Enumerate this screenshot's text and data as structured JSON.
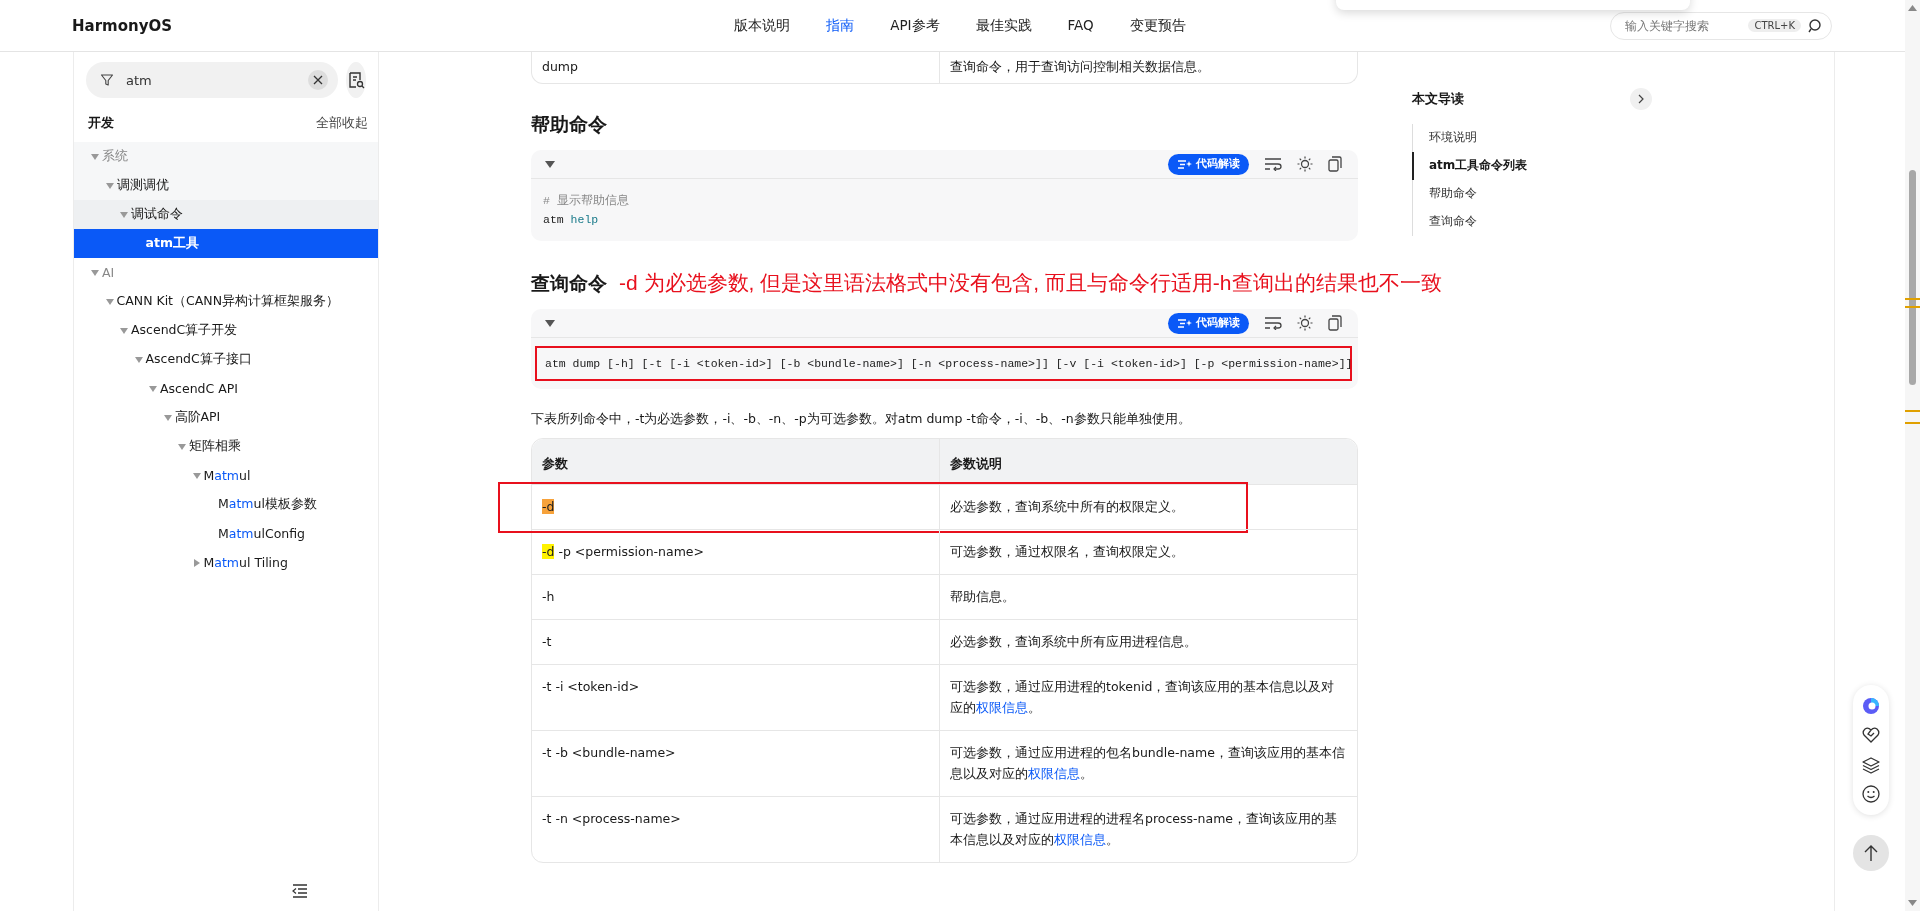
{
  "header": {
    "logo": "HarmonyOS",
    "nav": [
      {
        "label": "版本说明",
        "selected": false
      },
      {
        "label": "指南",
        "selected": true
      },
      {
        "label": "API参考",
        "selected": false
      },
      {
        "label": "最佳实践",
        "selected": false
      },
      {
        "label": "FAQ",
        "selected": false
      },
      {
        "label": "变更预告",
        "selected": false
      }
    ],
    "search": {
      "placeholder": "输入关键字搜索",
      "shortcut": "CTRL+K"
    }
  },
  "sidebar": {
    "filter": {
      "value": "atm"
    },
    "section": "开发",
    "collapse_all": "全部收起",
    "tree": [
      {
        "parts": [
          {
            "text": "系统",
            "match": false
          }
        ],
        "expanded": true,
        "selected": false,
        "children": [
          {
            "parts": [
              {
                "text": "调测调优",
                "match": false
              }
            ],
            "expanded": true,
            "selected": false,
            "children": [
              {
                "parts": [
                  {
                    "text": "调试命令",
                    "match": false
                  }
                ],
                "expanded": true,
                "selected": false,
                "children": [
                  {
                    "parts": [
                      {
                        "text": "atm",
                        "match": true
                      },
                      {
                        "text": "工具",
                        "match": false
                      }
                    ],
                    "selected": true
                  }
                ]
              }
            ]
          }
        ]
      },
      {
        "parts": [
          {
            "text": "AI",
            "match": false
          }
        ],
        "expanded": true,
        "selected": false,
        "children": [
          {
            "parts": [
              {
                "text": "CANN Kit（CANN异构计算框架服务）",
                "match": false
              }
            ],
            "expanded": true,
            "selected": false,
            "children": [
              {
                "parts": [
                  {
                    "text": "AscendC算子开发",
                    "match": false
                  }
                ],
                "expanded": true,
                "selected": false,
                "children": [
                  {
                    "parts": [
                      {
                        "text": "AscendC算子接口",
                        "match": false
                      }
                    ],
                    "expanded": true,
                    "selected": false,
                    "children": [
                      {
                        "parts": [
                          {
                            "text": "AscendC API",
                            "match": false
                          }
                        ],
                        "expanded": true,
                        "selected": false,
                        "children": [
                          {
                            "parts": [
                              {
                                "text": "高阶API",
                                "match": false
                              }
                            ],
                            "expanded": true,
                            "selected": false,
                            "children": [
                              {
                                "parts": [
                                  {
                                    "text": "矩阵相乘",
                                    "match": false
                                  }
                                ],
                                "expanded": true,
                                "selected": false,
                                "children": [
                                  {
                                    "parts": [
                                      {
                                        "text": "M",
                                        "match": false
                                      },
                                      {
                                        "text": "atm",
                                        "match": true
                                      },
                                      {
                                        "text": "ul",
                                        "match": false
                                      }
                                    ],
                                    "expanded": true,
                                    "selected": false,
                                    "children": [
                                      {
                                        "parts": [
                                          {
                                            "text": "M",
                                            "match": false
                                          },
                                          {
                                            "text": "atm",
                                            "match": true
                                          },
                                          {
                                            "text": "ul模板参数",
                                            "match": false
                                          }
                                        ],
                                        "selected": false
                                      },
                                      {
                                        "parts": [
                                          {
                                            "text": "M",
                                            "match": false
                                          },
                                          {
                                            "text": "atm",
                                            "match": true
                                          },
                                          {
                                            "text": "ulConfig",
                                            "match": false
                                          }
                                        ],
                                        "selected": false
                                      }
                                    ]
                                  },
                                  {
                                    "parts": [
                                      {
                                        "text": "M",
                                        "match": false
                                      },
                                      {
                                        "text": "atm",
                                        "match": true
                                      },
                                      {
                                        "text": "ul Tiling",
                                        "match": false
                                      }
                                    ],
                                    "expanded": false,
                                    "selected": false
                                  }
                                ]
                              }
                            ]
                          }
                        ]
                      }
                    ]
                  }
                ]
              }
            ]
          }
        ]
      }
    ]
  },
  "content": {
    "blocks": [
      {
        "kind": "table",
        "rows": [
          {
            "param": [
              {
                "text": "dump"
              }
            ],
            "description": [
              {
                "text": "查询命令，用于查询访问控制相关数据信息。"
              }
            ],
            "annotated": false
          }
        ]
      },
      {
        "kind": "heading",
        "text": "帮助命令"
      },
      {
        "kind": "code",
        "button": "代码解读",
        "annotated": false,
        "lines": [
          [
            {
              "text": "# 显示帮助信息",
              "kind": "comment"
            }
          ],
          [
            {
              "text": "atm ",
              "kind": "plain"
            },
            {
              "text": "help",
              "kind": "keyword"
            }
          ]
        ]
      },
      {
        "kind": "heading",
        "text": "查询命令",
        "annotation": "-d 为必选参数, 但是这里语法格式中没有包含, 而且与命令行适用-h查询出的结果也不一致"
      },
      {
        "kind": "code",
        "button": "代码解读",
        "annotated": true,
        "lines": [
          [
            {
              "text": "atm dump [-h] [-t [-i <token-id>] [-b <bundle-name>] [-n <process-name>]] [-v [-i <token-id>] [-p <permission-name>]]",
              "kind": "plain"
            }
          ]
        ]
      },
      {
        "kind": "paragraph",
        "text": "下表所列命令中，-t为必选参数，-i、-b、-n、-p为可选参数。对atm dump -t命令，-i、-b、-n参数只能单独使用。"
      },
      {
        "kind": "table",
        "columns": [
          "参数",
          "参数说明"
        ],
        "rows": [
          {
            "param": [
              {
                "text": "-d",
                "color": "#f7a23a"
              }
            ],
            "description": [
              {
                "text": "必选参数，查询系统中所有的权限定义。"
              }
            ],
            "annotated": true
          },
          {
            "param": [
              {
                "text": "-d",
                "color": "#fff200"
              },
              {
                "text": " -p <permission-name>"
              }
            ],
            "description": [
              {
                "text": "可选参数，通过权限名，查询权限定义。"
              }
            ],
            "annotated": false
          },
          {
            "param": [
              {
                "text": "-h"
              }
            ],
            "description": [
              {
                "text": "帮助信息。"
              }
            ],
            "annotated": false
          },
          {
            "param": [
              {
                "text": "-t"
              }
            ],
            "description": [
              {
                "text": "必选参数，查询系统中所有应用进程信息。"
              }
            ],
            "annotated": false
          },
          {
            "param": [
              {
                "text": "-t -i <token-id>"
              }
            ],
            "description": [
              {
                "text": "可选参数，通过应用进程的tokenid，查询该应用的基本信息以及对应的"
              },
              {
                "text": "权限信息",
                "kind": "link"
              },
              {
                "text": "。"
              }
            ],
            "annotated": false
          },
          {
            "param": [
              {
                "text": "-t -b <bundle-name>"
              }
            ],
            "description": [
              {
                "text": "可选参数，通过应用进程的包名bundle-name，查询该应用的基本信息以及对应的"
              },
              {
                "text": "权限信息",
                "kind": "link"
              },
              {
                "text": "。"
              }
            ],
            "annotated": false
          },
          {
            "param": [
              {
                "text": "-t -n <process-name>"
              }
            ],
            "description": [
              {
                "text": "可选参数，通过应用进程的进程名process-name，查询该应用的基本信息以及对应的"
              },
              {
                "text": "权限信息",
                "kind": "link"
              },
              {
                "text": "。"
              }
            ],
            "annotated": false
          }
        ]
      }
    ]
  },
  "toc": {
    "title": "本文导读",
    "items": [
      {
        "label": "环境说明",
        "selected": false
      },
      {
        "label": "atm工具命令列表",
        "selected": true
      },
      {
        "label": "帮助命令",
        "selected": false
      },
      {
        "label": "查询命令",
        "selected": false
      }
    ]
  }
}
